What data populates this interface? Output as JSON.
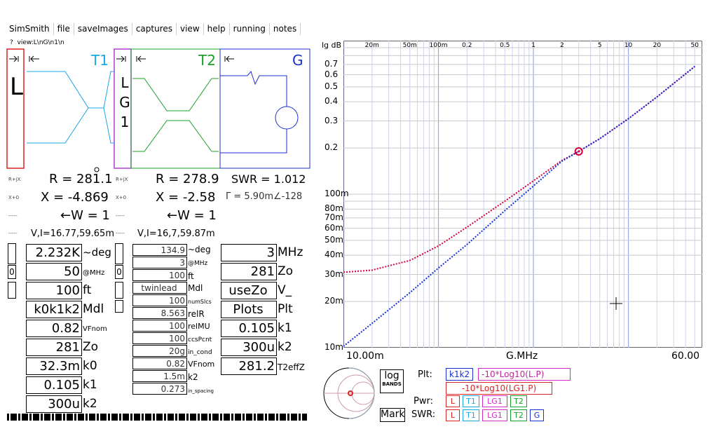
{
  "menu": [
    "SimSmith",
    "file",
    "saveImages",
    "captures",
    "view",
    "help",
    "running",
    "notes"
  ],
  "path_line": {
    "q": "?",
    "text": "view:L\\nG\\n1\\n"
  },
  "schematic": {
    "t1": "T1",
    "t2": "T2",
    "g": "G",
    "l_letter": "L",
    "lg": [
      "L",
      "G",
      "1"
    ],
    "colors": {
      "t1": "#1aa7e8",
      "t2": "#1aa12a",
      "g": "#1b2fd0",
      "l": "#d22",
      "lg": "#b43cd2"
    }
  },
  "readouts": {
    "r1": "R = 281.1",
    "x1": "X = -4.869",
    "w1": "←W = 1",
    "vi1": "V,I=16.77,59.65m",
    "r2": "R = 278.9",
    "x2": "X = -2.58",
    "w2": "←W = 1",
    "vi2": "V,I=16,7,59.87m",
    "swr": "SWR = 1.012",
    "gamma": "Γ = 5.90m∠-128"
  },
  "mini_labels": {
    "rx": "R+jX",
    "xo": "X+0",
    "dash": "-----"
  },
  "t1_params": [
    {
      "value": "2.232K",
      "label": "~deg"
    },
    {
      "value": "50",
      "label": "@MHz"
    },
    {
      "value": "100",
      "label": "ft"
    },
    {
      "value": "k0k1k2",
      "label": "Mdl"
    },
    {
      "value": "0.82",
      "label": "VFnom"
    },
    {
      "value": "281",
      "label": "Zo"
    },
    {
      "value": "32.3m",
      "label": "k0"
    },
    {
      "value": "0.105",
      "label": "k1"
    },
    {
      "value": "300u",
      "label": "k2"
    }
  ],
  "t2_params": [
    {
      "value": "134.9",
      "label": "~deg"
    },
    {
      "value": "3",
      "label": "@MHz"
    },
    {
      "value": "100",
      "label": "ft"
    },
    {
      "value": "twinlead",
      "label": "Mdl"
    },
    {
      "value": "100",
      "label": "numSlcs"
    },
    {
      "value": "8.563",
      "label": "relR"
    },
    {
      "value": "100",
      "label": "relMU"
    },
    {
      "value": "100",
      "label": "ccsPcnt"
    },
    {
      "value": "20g",
      "label": "in_cond"
    },
    {
      "value": "0.82",
      "label": "VFnom"
    },
    {
      "value": "1.5m",
      "label": "k2"
    },
    {
      "value": "0.273",
      "label": "in_spacing"
    }
  ],
  "g_params": [
    {
      "value": "3",
      "label": "MHz"
    },
    {
      "value": "281",
      "label": "Zo"
    },
    {
      "value": "useZo",
      "label": "V_"
    },
    {
      "value": "Plots",
      "label": "Plt"
    },
    {
      "value": "0.105",
      "label": "k1"
    },
    {
      "value": "300u",
      "label": "k2"
    },
    {
      "value": "281.2",
      "label": "T2effZ"
    }
  ],
  "chart_data": {
    "type": "line",
    "ylabel": "lg dB",
    "xlabel": "G.MHz",
    "x_start": "10.00m",
    "x_end": "60.00",
    "x_scale": "log",
    "y_scale": "log",
    "xlim": [
      0.01,
      60
    ],
    "ylim": [
      0.01,
      1
    ],
    "x_ticks": [
      "20m",
      "50m",
      "100m",
      "0.2",
      "0.5",
      "1",
      "2",
      "5",
      "10",
      "20",
      "50"
    ],
    "y_ticks": [
      "0.7",
      "0.6",
      "0.5",
      "0.4",
      "0.3",
      "0.2",
      "100m",
      "80m",
      "70m",
      "60m",
      "50m",
      "40m",
      "30m",
      "20m",
      "10m"
    ],
    "series": [
      {
        "color": "#d4003a",
        "x": [
          0.01,
          0.02,
          0.05,
          0.1,
          0.2,
          0.5,
          1,
          2,
          3,
          5,
          10,
          20,
          50
        ],
        "y": [
          0.031,
          0.032,
          0.037,
          0.046,
          0.061,
          0.09,
          0.122,
          0.166,
          0.19,
          0.23,
          0.31,
          0.43,
          0.68
        ]
      },
      {
        "color": "#1730d9",
        "x": [
          0.01,
          0.02,
          0.05,
          0.1,
          0.2,
          0.5,
          1,
          2,
          3,
          5,
          10,
          20,
          50
        ],
        "y": [
          0.0102,
          0.0144,
          0.0228,
          0.033,
          0.047,
          0.078,
          0.113,
          0.164,
          0.19,
          0.23,
          0.31,
          0.43,
          0.68
        ]
      }
    ],
    "marker": {
      "x": 3,
      "y": 0.19
    },
    "grid": true
  },
  "bottom": {
    "log": "log",
    "bands": "BANDS",
    "mark": "Mark",
    "plt": "Plt:",
    "pwr": "Pwr:",
    "swr": "SWR:",
    "legend": [
      "k1k2",
      "-10*Log10(L.P)",
      "-10*Log10(LG1.P)"
    ],
    "checks": [
      "L",
      "T1",
      "LG1",
      "T2",
      "G"
    ]
  }
}
